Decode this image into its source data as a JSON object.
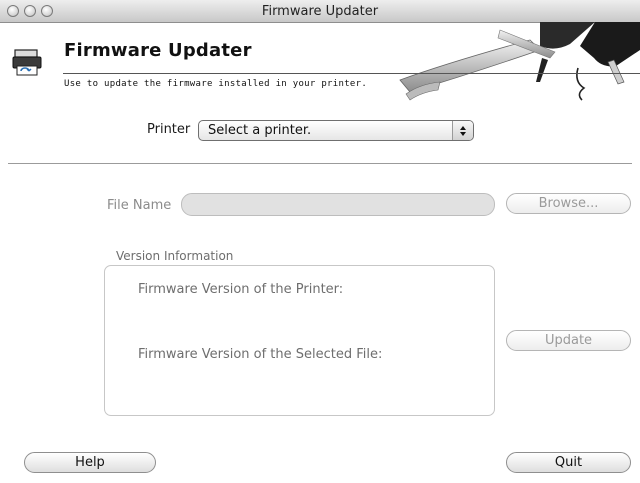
{
  "window": {
    "title": "Firmware Updater"
  },
  "header": {
    "title": "Firmware Updater",
    "subtitle": "Use to update the firmware installed in your printer.",
    "icon": "printer-icon",
    "banner_icon": "pliers-tool-icon"
  },
  "printer": {
    "label": "Printer",
    "selected": "Select a printer."
  },
  "file": {
    "label": "File Name",
    "value": "",
    "browse_label": "Browse..."
  },
  "version": {
    "label": "Version Information",
    "printer_fw_label": "Firmware Version of the Printer:",
    "file_fw_label": "Firmware Version of the Selected File:"
  },
  "buttons": {
    "update": "Update",
    "help": "Help",
    "quit": "Quit"
  }
}
